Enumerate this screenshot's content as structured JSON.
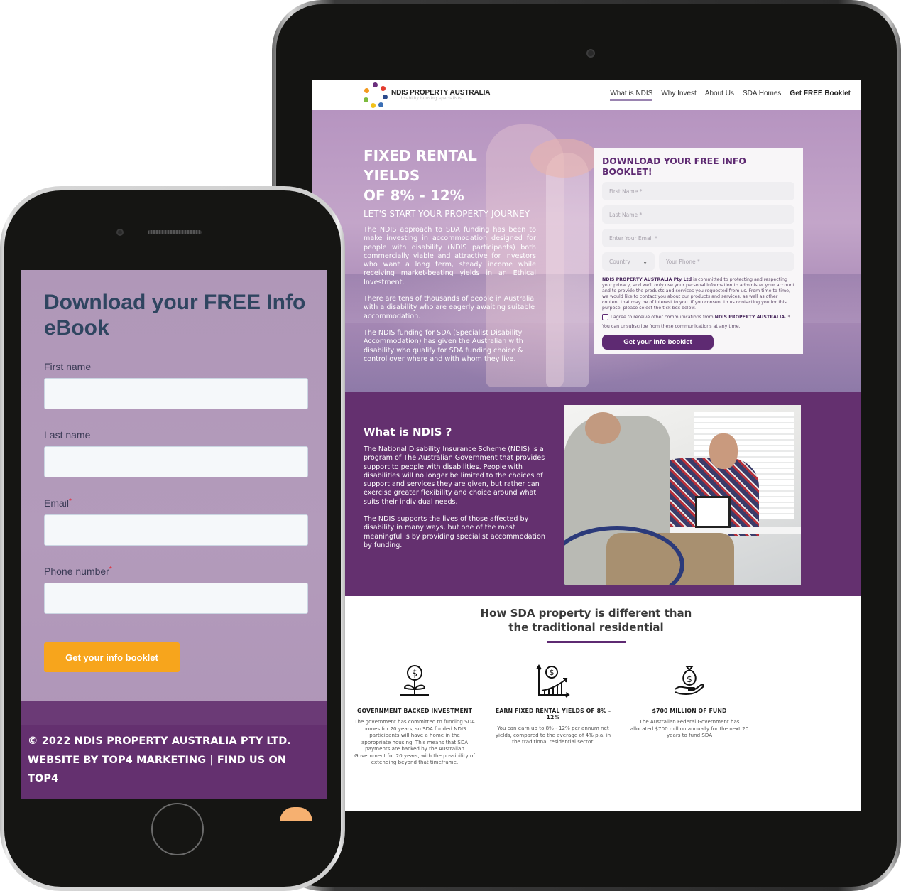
{
  "tablet": {
    "header": {
      "logo_name": "NDIS PROPERTY AUSTRALIA",
      "logo_tagline": "disability housing specialists",
      "nav": [
        {
          "label": "What is NDIS",
          "active": true
        },
        {
          "label": "Why Invest",
          "active": false
        },
        {
          "label": "About Us",
          "active": false
        },
        {
          "label": "SDA Homes",
          "active": false
        },
        {
          "label": "Get FREE Booklet",
          "active": false
        }
      ]
    },
    "hero": {
      "title_line1": "FIXED RENTAL YIELDS",
      "title_line2": "OF 8% - 12%",
      "subtitle": "LET'S START YOUR PROPERTY JOURNEY",
      "paragraphs": [
        "The NDIS approach to SDA funding has been to make investing in accommodation designed for people with disability (NDIS participants) both commercially viable and attractive for investors who want a long term, steady income while receiving market-beating yields in an Ethical Investment.",
        "There are tens of thousands of people in Australia with a disability who are eagerly awaiting suitable accommodation.",
        "The NDIS funding for SDA (Specialist Disability Accommodation) has given the Australian with disability who qualify for SDA funding choice & control over where and with whom they live."
      ]
    },
    "form": {
      "title": "DOWNLOAD YOUR FREE INFO BOOKLET!",
      "first_name_placeholder": "First Name *",
      "last_name_placeholder": "Last Name *",
      "email_placeholder": "Enter Your Email *",
      "country_selected": "Country",
      "phone_placeholder": "Your Phone *",
      "privacy_company": "NDIS PROPERTY AUSTRALIA Pty Ltd",
      "privacy_text": " is committed to protecting and respecting your privacy, and we'll only use your personal information to administer your account and to provide the products and services you requested from us. From time to time, we would like to contact you about our products and services, as well as other content that may be of interest to you. If you consent to us contacting you for this purpose, please select the tick box below.",
      "agree_text": "I agree to receive other communications from ",
      "agree_company": "NDIS PROPERTY AUSTRALIA.",
      "agree_required": " *",
      "agree_checked": false,
      "unsubscribe_text": "You can unsubscribe from these communications at any time.",
      "submit_label": "Get your info booklet"
    },
    "ndis": {
      "title": "What is NDIS ?",
      "paragraphs": [
        "The National Disability Insurance Scheme (NDIS) is a program of The Australian Government that provides support to people with disabilities. People with disabilities will no longer be limited to the choices of support and services they are given, but rather can exercise greater flexibility and choice around what suits their individual needs.",
        "The NDIS supports the lives of those affected by disability in many ways, but one of the most meaningful is by providing specialist accommodation by funding."
      ]
    },
    "sda": {
      "title_line1": "How SDA property is different than",
      "title_line2": "the traditional residential",
      "features": [
        {
          "icon": "money-plant-icon",
          "title": "GOVERNMENT BACKED INVESTMENT",
          "text": "The government has committed to funding SDA homes for 20 years, so SDA funded NDIS participants will have a home in the appropriate housing. This means that SDA payments are backed by the Australian Government for 20 years, with the possibility of extending beyond that timeframe."
        },
        {
          "icon": "growth-chart-icon",
          "title": "EARN FIXED RENTAL YIELDS OF 8% - 12%",
          "text": "You can earn up to 8% - 12% per annum net yields, compared to the average of 4% p.a. in the traditional residential sector."
        },
        {
          "icon": "money-bag-hand-icon",
          "title": "$700 MILLION OF FUND",
          "text": "The Australian Federal Government has allocated $700 million annually for the next 20 years to fund SDA"
        }
      ],
      "more_icons": [
        "contract-house-icon",
        "shield-hands-icon"
      ]
    }
  },
  "phone": {
    "form": {
      "title": "Download your FREE Info eBook",
      "fields": [
        {
          "label": "First name",
          "required": false,
          "value": ""
        },
        {
          "label": "Last name",
          "required": false,
          "value": ""
        },
        {
          "label": "Email",
          "required": true,
          "value": ""
        },
        {
          "label": "Phone number",
          "required": true,
          "value": ""
        }
      ],
      "required_mark": "*",
      "submit_label": "Get your info booklet"
    },
    "footer": {
      "line1": "© 2022 NDIS PROPERTY AUSTRALIA PTY LTD.",
      "line2": "WEBSITE BY TOP4 MARKETING | FIND US ON TOP4"
    }
  },
  "colors": {
    "brand_purple": "#64306f",
    "form_title_purple": "#5e2a72",
    "phone_button_orange": "#f7a51c",
    "phone_title_navy": "#2f4560"
  }
}
